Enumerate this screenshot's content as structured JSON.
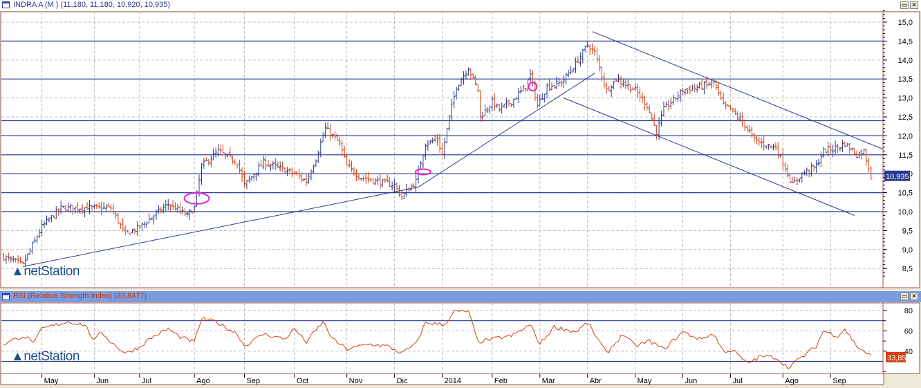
{
  "price_panel": {
    "title": "INDRA A (M ) (11,180, 11,180, 10,920, 10,935)",
    "last_value": "10,935",
    "y_ticks": [
      "15,0",
      "14,5",
      "14,0",
      "13,5",
      "13,0",
      "12,5",
      "12,0",
      "11,5",
      "11,0",
      "10,5",
      "10,0",
      "9,5",
      "9,0",
      "8,5"
    ],
    "y_tick_values": [
      15,
      14.5,
      14,
      13.5,
      13,
      12.5,
      12,
      11.5,
      11,
      10.5,
      10,
      9.5,
      9,
      8.5
    ],
    "ylim": [
      8.2,
      15.3
    ],
    "horizontal_levels": [
      14.5,
      13.5,
      12.4,
      12.0,
      11.5,
      11.0,
      10.5,
      10.0
    ],
    "trend_lines": [
      [
        [
          9,
          8.55
        ],
        [
          175,
          10.65
        ],
        [
          249,
          13.65
        ]
      ],
      [
        [
          248,
          14.75
        ],
        [
          370,
          11.65
        ]
      ],
      [
        [
          236,
          13.0
        ],
        [
          358,
          9.9
        ]
      ]
    ],
    "markers": [
      {
        "day": 82,
        "value": 10.35,
        "shape": "ellipse-large"
      },
      {
        "day": 177,
        "value": 11.05,
        "shape": "ellipse-small"
      },
      {
        "day": 223,
        "value": 13.3,
        "shape": "circle"
      }
    ],
    "close_points": [
      [
        1,
        8.8
      ],
      [
        9,
        8.6
      ],
      [
        17,
        9.6
      ],
      [
        25,
        10.1
      ],
      [
        39,
        10.1
      ],
      [
        46,
        10.1
      ],
      [
        52,
        9.4
      ],
      [
        58,
        9.6
      ],
      [
        70,
        10.2
      ],
      [
        78,
        9.9
      ],
      [
        81,
        10.1
      ],
      [
        84,
        11.2
      ],
      [
        91,
        11.6
      ],
      [
        99,
        11.3
      ],
      [
        102,
        10.7
      ],
      [
        110,
        11.3
      ],
      [
        119,
        11.1
      ],
      [
        123,
        11.0
      ],
      [
        128,
        10.8
      ],
      [
        132,
        11.4
      ],
      [
        136,
        12.2
      ],
      [
        142,
        11.8
      ],
      [
        145,
        11.2
      ],
      [
        151,
        10.9
      ],
      [
        158,
        10.8
      ],
      [
        165,
        10.7
      ],
      [
        168,
        10.4
      ],
      [
        174,
        10.8
      ],
      [
        178,
        11.8
      ],
      [
        183,
        11.9
      ],
      [
        185,
        11.5
      ],
      [
        188,
        12.5
      ],
      [
        191,
        13.3
      ],
      [
        196,
        13.8
      ],
      [
        200,
        13.2
      ],
      [
        201,
        12.5
      ],
      [
        206,
        12.9
      ],
      [
        209,
        12.7
      ],
      [
        214,
        12.9
      ],
      [
        220,
        13.3
      ],
      [
        222,
        13.6
      ],
      [
        225,
        12.8
      ],
      [
        229,
        13.3
      ],
      [
        235,
        13.4
      ],
      [
        241,
        13.9
      ],
      [
        246,
        14.4
      ],
      [
        249,
        14.2
      ],
      [
        254,
        13.2
      ],
      [
        258,
        13.5
      ],
      [
        261,
        13.4
      ],
      [
        266,
        13.2
      ],
      [
        271,
        12.8
      ],
      [
        275,
        12.1
      ],
      [
        278,
        12.7
      ],
      [
        286,
        13.2
      ],
      [
        293,
        13.3
      ],
      [
        299,
        13.4
      ],
      [
        303,
        12.8
      ],
      [
        306,
        12.7
      ],
      [
        312,
        12.3
      ],
      [
        316,
        11.9
      ],
      [
        319,
        11.8
      ],
      [
        325,
        11.7
      ],
      [
        328,
        11.3
      ],
      [
        332,
        10.7
      ],
      [
        336,
        11.0
      ],
      [
        342,
        11.2
      ],
      [
        345,
        11.6
      ],
      [
        351,
        11.7
      ],
      [
        354,
        11.8
      ],
      [
        359,
        11.5
      ],
      [
        362,
        11.6
      ],
      [
        365,
        10.94
      ]
    ]
  },
  "rsi_panel": {
    "title": "RSI (Relative Strength Index) (33,8477)",
    "last_value": "33,85",
    "y_ticks": [
      "80",
      "60",
      "40"
    ],
    "y_tick_values": [
      80,
      60,
      40
    ],
    "ylim": [
      14,
      84
    ],
    "levels": [
      70,
      30
    ],
    "points": [
      [
        1,
        47
      ],
      [
        9,
        55
      ],
      [
        14,
        49
      ],
      [
        17,
        62
      ],
      [
        23,
        66
      ],
      [
        28,
        69
      ],
      [
        35,
        66
      ],
      [
        39,
        50
      ],
      [
        42,
        59
      ],
      [
        46,
        49
      ],
      [
        52,
        38
      ],
      [
        58,
        44
      ],
      [
        62,
        52
      ],
      [
        70,
        62
      ],
      [
        75,
        54
      ],
      [
        81,
        49
      ],
      [
        84,
        72
      ],
      [
        90,
        69
      ],
      [
        99,
        57
      ],
      [
        102,
        45
      ],
      [
        110,
        57
      ],
      [
        119,
        52
      ],
      [
        123,
        62
      ],
      [
        128,
        49
      ],
      [
        135,
        69
      ],
      [
        139,
        52
      ],
      [
        145,
        42
      ],
      [
        154,
        47
      ],
      [
        162,
        45
      ],
      [
        168,
        38
      ],
      [
        174,
        47
      ],
      [
        178,
        68
      ],
      [
        186,
        66
      ],
      [
        190,
        79
      ],
      [
        196,
        79
      ],
      [
        200,
        49
      ],
      [
        206,
        52
      ],
      [
        214,
        55
      ],
      [
        222,
        66
      ],
      [
        226,
        47
      ],
      [
        232,
        64
      ],
      [
        241,
        59
      ],
      [
        246,
        68
      ],
      [
        254,
        38
      ],
      [
        261,
        57
      ],
      [
        266,
        45
      ],
      [
        272,
        50
      ],
      [
        278,
        42
      ],
      [
        286,
        59
      ],
      [
        293,
        52
      ],
      [
        299,
        57
      ],
      [
        303,
        40
      ],
      [
        307,
        41
      ],
      [
        313,
        28
      ],
      [
        319,
        35
      ],
      [
        325,
        34
      ],
      [
        330,
        24
      ],
      [
        336,
        34
      ],
      [
        342,
        45
      ],
      [
        345,
        60
      ],
      [
        351,
        55
      ],
      [
        354,
        62
      ],
      [
        359,
        45
      ],
      [
        365,
        35
      ]
    ]
  },
  "x_axis": {
    "months": [
      {
        "label": "May",
        "day": 17
      },
      {
        "label": "Jun",
        "day": 39
      },
      {
        "label": "Jul",
        "day": 58
      },
      {
        "label": "Ago",
        "day": 81
      },
      {
        "label": "Sep",
        "day": 102
      },
      {
        "label": "Oct",
        "day": 123
      },
      {
        "label": "Nov",
        "day": 145
      },
      {
        "label": "Dic",
        "day": 165
      },
      {
        "label": "2014",
        "day": 185
      },
      {
        "label": "Feb",
        "day": 206
      },
      {
        "label": "Mar",
        "day": 226
      },
      {
        "label": "Abr",
        "day": 246
      },
      {
        "label": "May",
        "day": 266
      },
      {
        "label": "Jun",
        "day": 286
      },
      {
        "label": "Jul",
        "day": 306
      },
      {
        "label": "Ago",
        "day": 328
      },
      {
        "label": "Sep",
        "day": 348
      }
    ],
    "total_days": 370
  },
  "logo": {
    "prefix": "net",
    "suffix": "Station"
  },
  "colors": {
    "up": "#2a3a90",
    "down": "#d04010",
    "level": "#2a3a90",
    "marker": "#e020d0",
    "rsi": "#d04010",
    "frame": "#a05050"
  }
}
